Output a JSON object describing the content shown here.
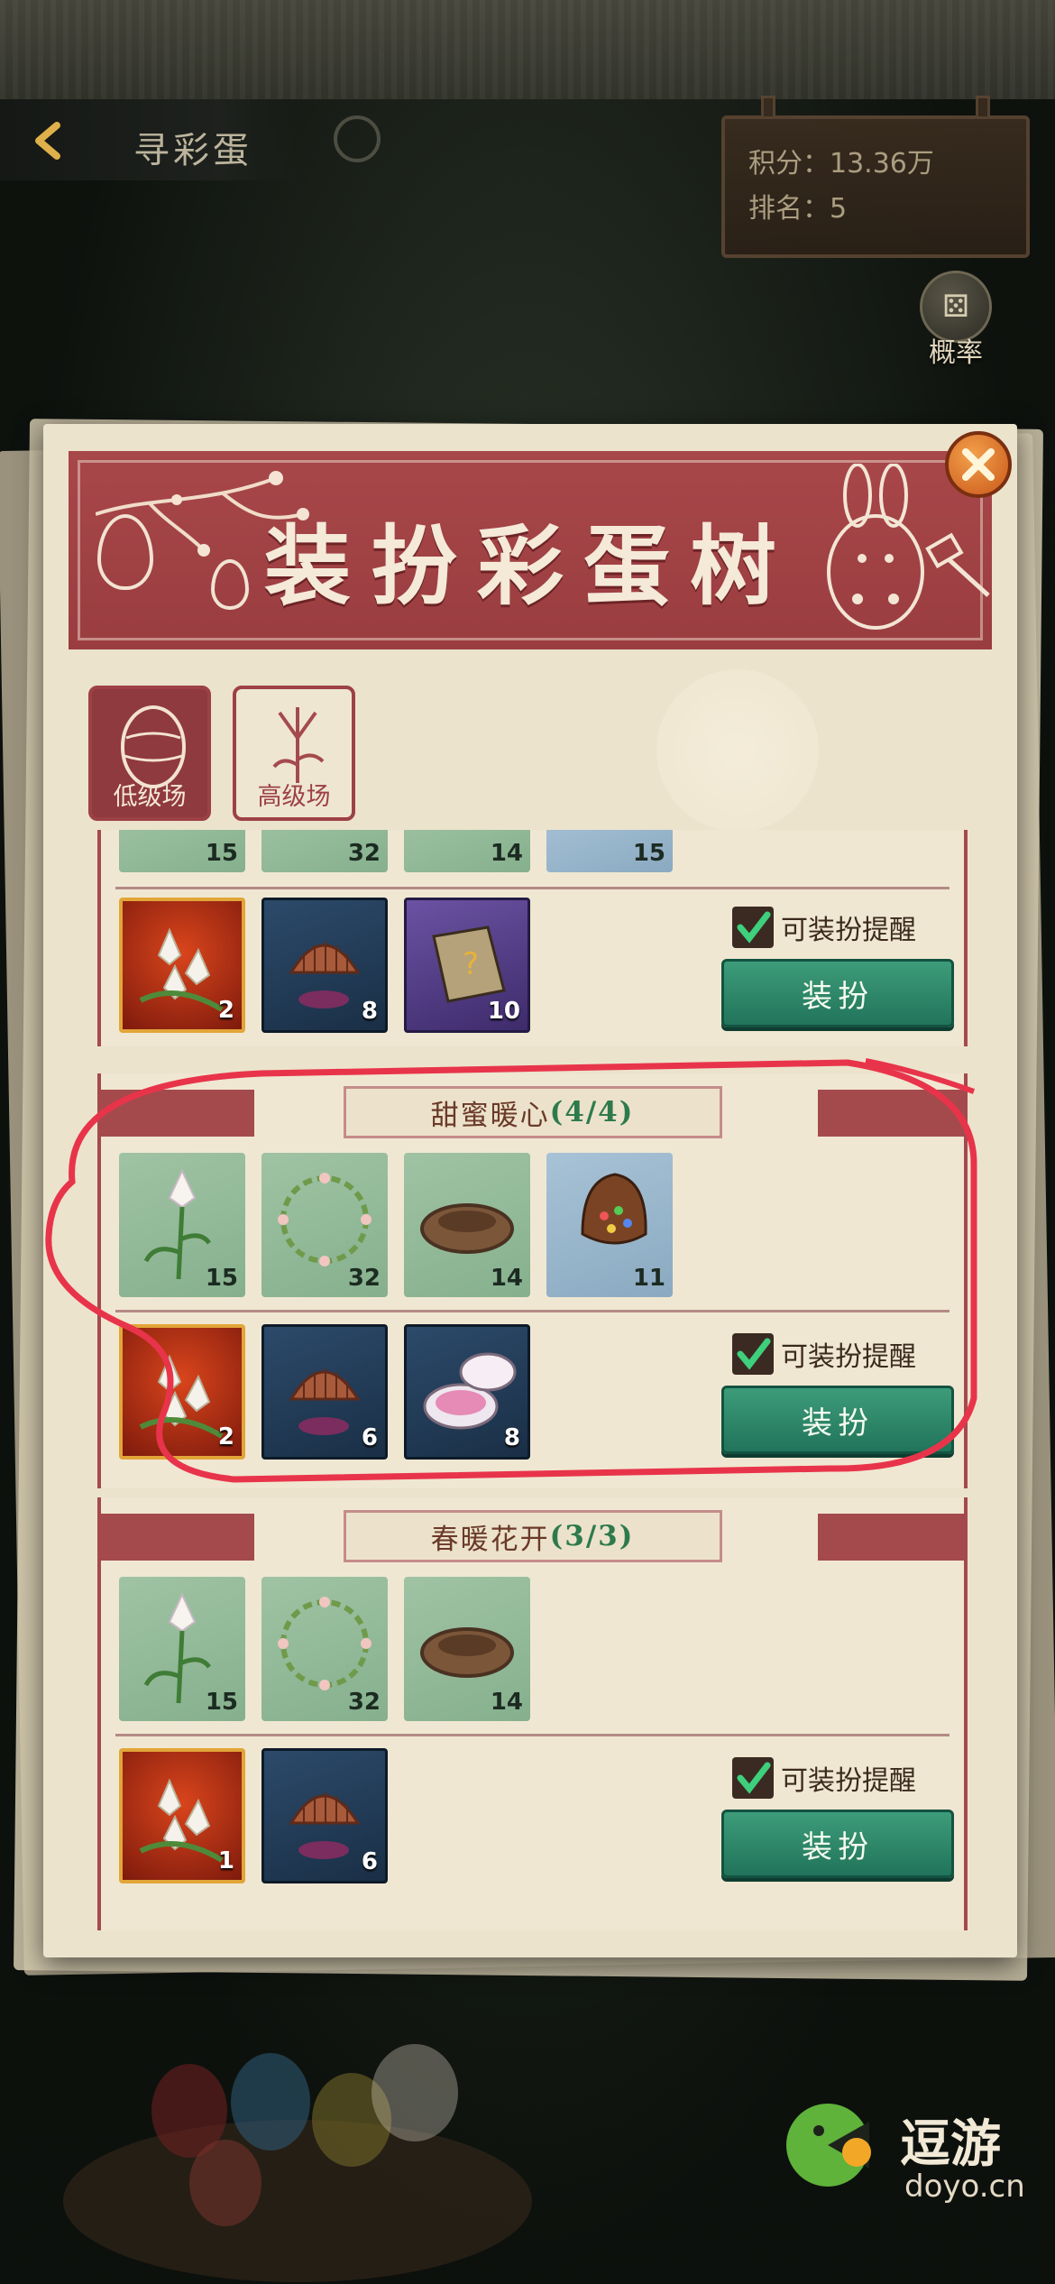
{
  "header": {
    "title": "寻彩蛋",
    "score_label": "积分：13.36万",
    "rank_label": "排名：5",
    "rate_label": "概率"
  },
  "panel": {
    "title": "装扮彩蛋树",
    "tabs": [
      {
        "label": "低级场",
        "active": true
      },
      {
        "label": "高级场",
        "active": false
      }
    ]
  },
  "sections": [
    {
      "title": "",
      "progress": "",
      "top_items": [
        {
          "icon": "lily-flower-icon",
          "count": "15"
        },
        {
          "icon": "flower-wreath-icon",
          "count": "32"
        },
        {
          "icon": "bird-nest-icon",
          "count": "14"
        },
        {
          "icon": "bird-creature-icon",
          "count": "15"
        }
      ],
      "bottom_items": [
        {
          "icon": "lily-bouquet-icon",
          "count": "2"
        },
        {
          "icon": "wooden-comb-icon",
          "count": "8"
        },
        {
          "icon": "mystery-book-icon",
          "count": "10"
        }
      ],
      "remind_label": "可装扮提醒",
      "button_label": "装扮"
    },
    {
      "title": "甜蜜暖心",
      "progress": "(4/4)",
      "top_items": [
        {
          "icon": "lily-flower-icon",
          "count": "15"
        },
        {
          "icon": "flower-wreath-icon",
          "count": "32"
        },
        {
          "icon": "bird-nest-icon",
          "count": "14"
        },
        {
          "icon": "chocolate-egg-icon",
          "count": "11"
        }
      ],
      "bottom_items": [
        {
          "icon": "lily-bouquet-icon",
          "count": "2"
        },
        {
          "icon": "wooden-comb-icon",
          "count": "6"
        },
        {
          "icon": "rouge-box-icon",
          "count": "8"
        }
      ],
      "remind_label": "可装扮提醒",
      "button_label": "装扮"
    },
    {
      "title": "春暖花开",
      "progress": "(3/3)",
      "top_items": [
        {
          "icon": "lily-flower-icon",
          "count": "15"
        },
        {
          "icon": "flower-wreath-icon",
          "count": "32"
        },
        {
          "icon": "bird-nest-icon",
          "count": "14"
        }
      ],
      "bottom_items": [
        {
          "icon": "lily-bouquet-icon",
          "count": "1"
        },
        {
          "icon": "wooden-comb-icon",
          "count": "6"
        }
      ],
      "remind_label": "可装扮提醒",
      "button_label": "装扮"
    }
  ],
  "watermark": {
    "name": "逗游",
    "site": "doyo.cn"
  },
  "colors": {
    "panel_red": "#a44a4d",
    "button_green": "#2f8a69",
    "progress_green": "#2e7a4c",
    "annotation_red": "#e8344a"
  }
}
